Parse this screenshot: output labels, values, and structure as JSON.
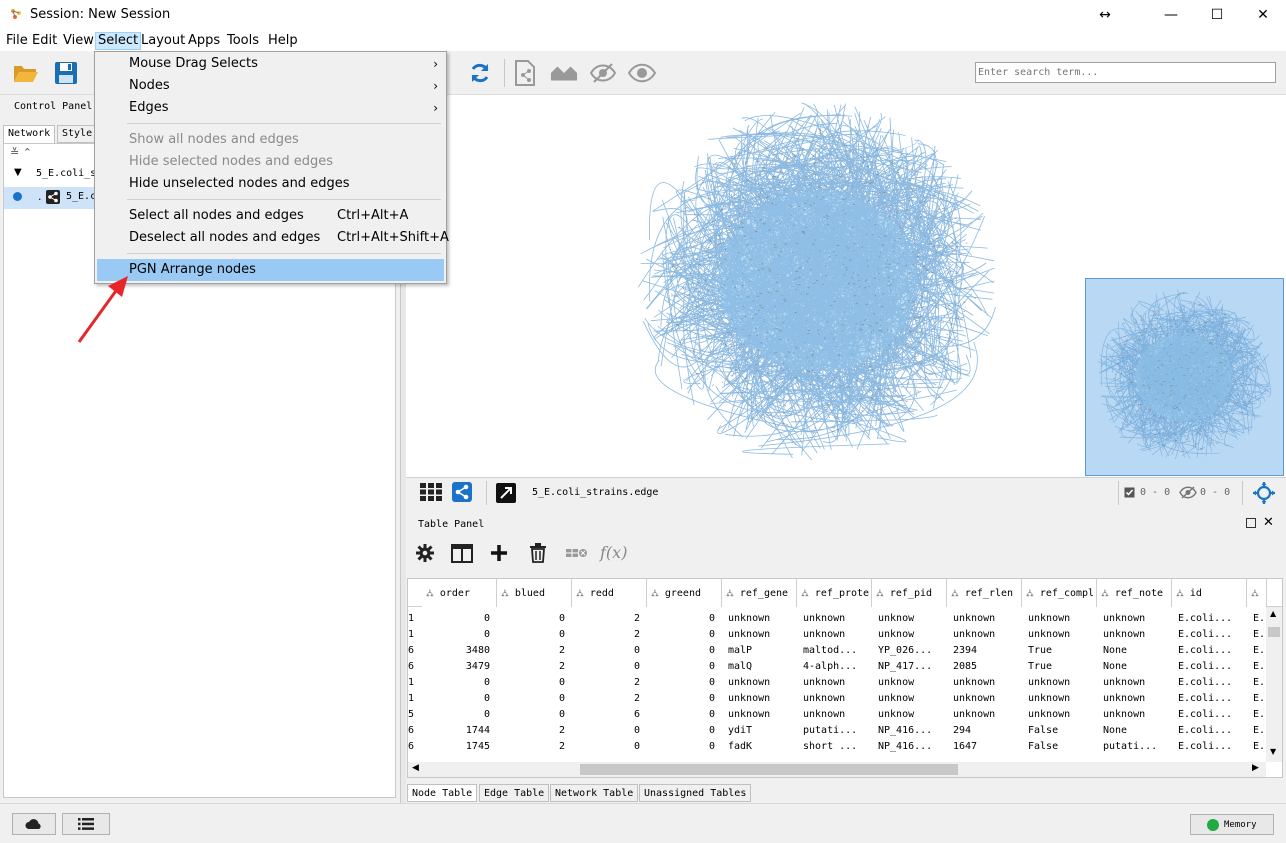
{
  "window": {
    "title": "Session: New Session",
    "maximize_symbol": "☐",
    "minimize_symbol": "—",
    "close_symbol": "✕"
  },
  "menubar": {
    "items": [
      "File",
      "Edit",
      "View",
      "Select",
      "Layout",
      "Apps",
      "Tools",
      "Help"
    ],
    "active": "Select"
  },
  "search": {
    "placeholder": "Enter search term..."
  },
  "left_panel": {
    "title": "Control Panel",
    "tabs": [
      "Network",
      "Style"
    ],
    "network_collection": "5_E.coli_s",
    "network_item": "5_E.c"
  },
  "select_menu": {
    "items": [
      {
        "label": "Mouse Drag Selects",
        "submenu": true
      },
      {
        "label": "Nodes",
        "submenu": true
      },
      {
        "label": "Edges",
        "submenu": true
      },
      {
        "label": "Show all nodes and edges",
        "disabled": true
      },
      {
        "label": "Hide selected nodes and edges",
        "disabled": true
      },
      {
        "label": "Hide unselected nodes and edges"
      },
      {
        "label": "Select all nodes and edges",
        "shortcut": "Ctrl+Alt+A"
      },
      {
        "label": "Deselect all nodes and edges",
        "shortcut": "Ctrl+Alt+Shift+A"
      },
      {
        "label": "PGN Arrange nodes",
        "highlighted": true
      }
    ]
  },
  "network_footer": {
    "network_name": "5_E.coli_strains.edge",
    "selected_count": "0 - 0",
    "hidden_count": "0 - 0"
  },
  "table_panel": {
    "title": "Table Panel",
    "columns": [
      "order",
      "blued",
      "redd",
      "greend",
      "ref_gene",
      "ref_prote",
      "ref_pid",
      "ref_rlen",
      "ref_compl",
      "ref_note",
      "id"
    ],
    "rows": [
      [
        "1",
        "0",
        "0",
        "2",
        "0",
        "unknown",
        "unknown",
        "unknow",
        "unknown",
        "unknown",
        "unknown",
        "E.coli...",
        "E."
      ],
      [
        "1",
        "0",
        "0",
        "2",
        "0",
        "unknown",
        "unknown",
        "unknow",
        "unknown",
        "unknown",
        "unknown",
        "E.coli...",
        "E."
      ],
      [
        "6",
        "3480",
        "2",
        "0",
        "0",
        "malP",
        "maltod...",
        "YP_026...",
        "2394",
        "True",
        "None",
        "E.coli...",
        "E."
      ],
      [
        "6",
        "3479",
        "2",
        "0",
        "0",
        "malQ",
        "4-alph...",
        "NP_417...",
        "2085",
        "True",
        "None",
        "E.coli...",
        "E."
      ],
      [
        "1",
        "0",
        "0",
        "2",
        "0",
        "unknown",
        "unknown",
        "unknow",
        "unknown",
        "unknown",
        "unknown",
        "E.coli...",
        "E."
      ],
      [
        "1",
        "0",
        "0",
        "2",
        "0",
        "unknown",
        "unknown",
        "unknow",
        "unknown",
        "unknown",
        "unknown",
        "E.coli...",
        "E."
      ],
      [
        "5",
        "0",
        "0",
        "6",
        "0",
        "unknown",
        "unknown",
        "unknow",
        "unknown",
        "unknown",
        "unknown",
        "E.coli...",
        "E."
      ],
      [
        "6",
        "1744",
        "2",
        "0",
        "0",
        "ydiT",
        "putati...",
        "NP_416...",
        "294",
        "False",
        "None",
        "E.coli...",
        "E."
      ],
      [
        "6",
        "1745",
        "2",
        "0",
        "0",
        "fadK",
        "short ...",
        "NP_416...",
        "1647",
        "False",
        "putati...",
        "E.coli...",
        "E."
      ]
    ],
    "tabs": [
      "Node Table",
      "Edge Table",
      "Network Table",
      "Unassigned Tables"
    ],
    "active_tab": "Node Table"
  },
  "status": {
    "memory_label": "Memory",
    "memory_color": "#22aa44"
  },
  "colors": {
    "accent": "#99c9f5",
    "network_edge": "#6fa8d8",
    "network_node": "#8fc3ea",
    "minimap": "#b8d8f4",
    "annotation_arrow": "#e8262a",
    "icon_blue": "#1a73c8"
  }
}
